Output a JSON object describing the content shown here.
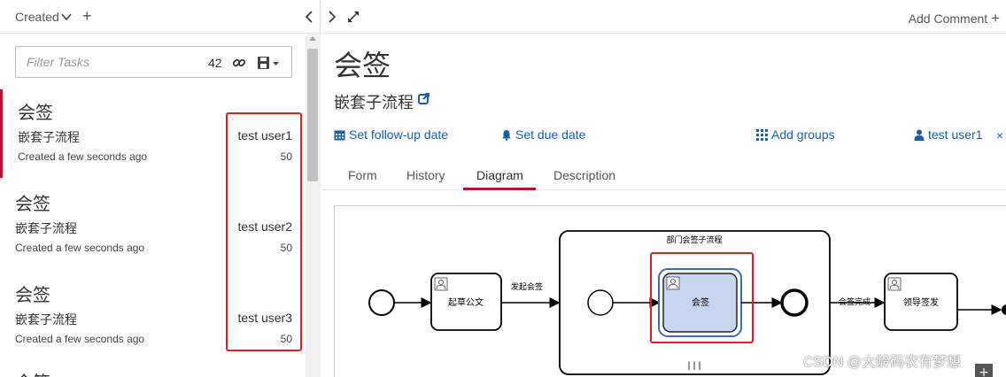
{
  "left_panel": {
    "sort_label": "Created",
    "filter": {
      "placeholder": "Filter Tasks",
      "count": "42"
    },
    "tasks": [
      {
        "title": "会签",
        "process": "嵌套子流程",
        "assignee": "test user1",
        "created": "Created a few seconds ago",
        "priority": "50"
      },
      {
        "title": "会签",
        "process": "嵌套子流程",
        "assignee": "test user2",
        "created": "Created a few seconds ago",
        "priority": "50"
      },
      {
        "title": "会签",
        "process": "嵌套子流程",
        "assignee": "test user3",
        "created": "Created a few seconds ago",
        "priority": "50"
      }
    ],
    "partial_task_title": "会签"
  },
  "right_panel": {
    "add_comment": "Add Comment",
    "task_name": "会签",
    "process_name": "嵌套子流程",
    "actions": {
      "follow_up": "Set follow-up date",
      "due_date": "Set due date",
      "add_groups": "Add groups",
      "assignee": "test user1",
      "remove_assignee": "×"
    },
    "tabs": [
      "Form",
      "History",
      "Diagram",
      "Description"
    ],
    "active_tab": "Diagram"
  },
  "diagram": {
    "subprocess_label": "部门会签子流程",
    "task_draft": "起草公文",
    "flow_issue": "发起会签",
    "task_countersign": "会签",
    "flow_done": "会签完成",
    "task_leader": "领导签发"
  },
  "watermark": "CSDN @大龄码农有梦想",
  "colors": {
    "accent_red": "#b5152b",
    "link_blue": "#1a5ea8",
    "highlight_red": "#e0201a",
    "task_fill": "#c7d6ee"
  }
}
